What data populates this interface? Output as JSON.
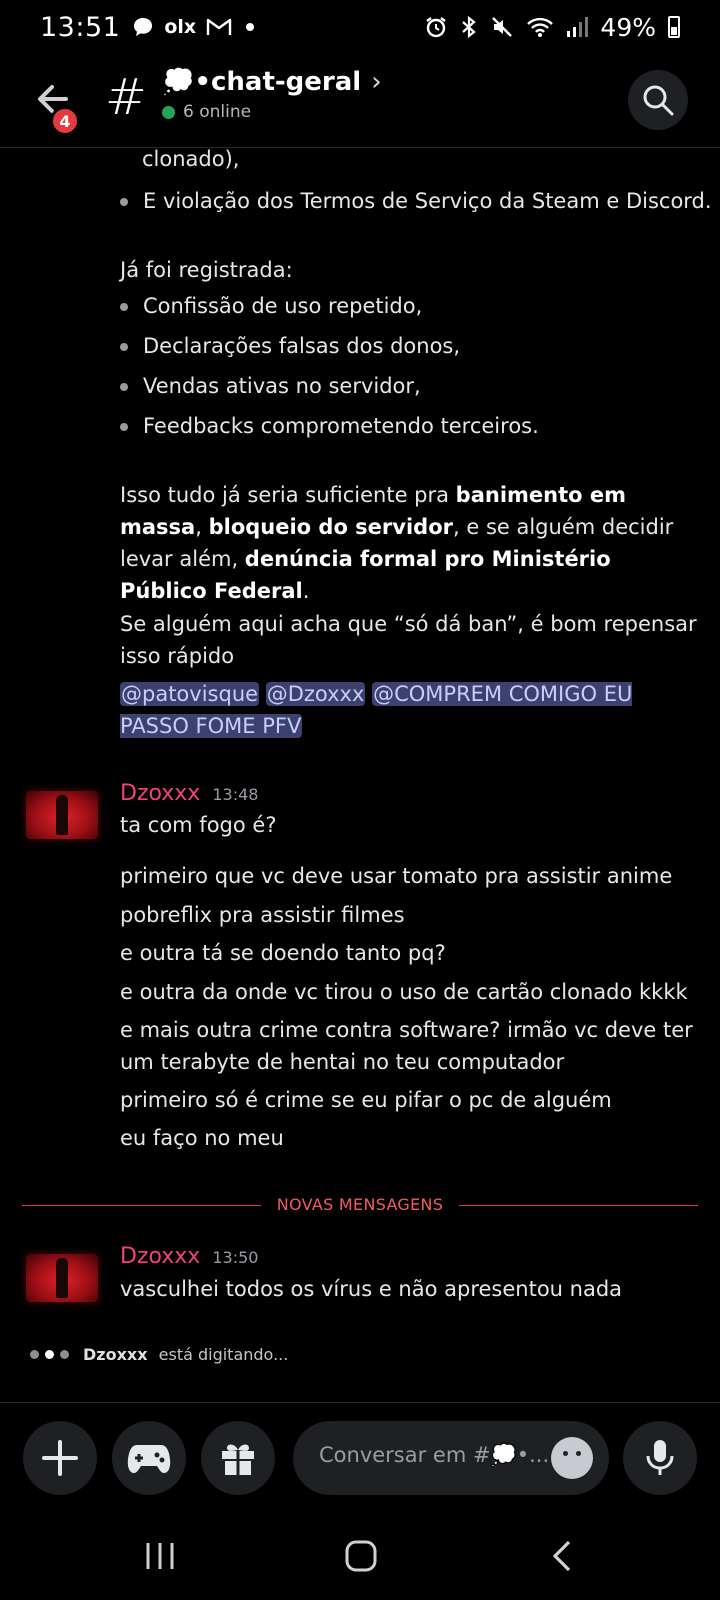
{
  "status_bar": {
    "time": "13:51",
    "left_icons": [
      "chat-bubble-icon",
      "olx-icon",
      "gmail-icon",
      "dot-icon"
    ],
    "olx_text": "olx",
    "battery": "49%",
    "right_icons": [
      "alarm-icon",
      "bluetooth-icon",
      "mute-icon",
      "wifi-icon",
      "signal-icon",
      "battery-icon"
    ]
  },
  "header": {
    "back_badge": "4",
    "channel_name": "💭•chat-geral",
    "chevron": "›",
    "online_text": "6 online",
    "online_color": "#23a55a"
  },
  "messages": {
    "top_block": {
      "partial_line": "clonado),",
      "bullet_1": "E violação dos Termos de Serviço da Steam e Discord.",
      "registered_heading": "Já foi registrada:",
      "registered_items": [
        "Confissão de uso repetido,",
        "Declarações falsas dos donos,",
        "Vendas ativas no servidor,",
        "Feedbacks comprometendo terceiros."
      ],
      "para_1_start": "Isso tudo já seria suficiente pra ",
      "para_1_bold_1": "banimento em massa",
      "para_1_mid_1": ", ",
      "para_1_bold_2": "bloqueio do servidor",
      "para_1_mid_2": ", e se alguém decidir levar além, ",
      "para_1_bold_3": "denúncia formal pro Ministério Público Federal",
      "para_1_end": ".",
      "para_2": "Se alguém aqui acha que “só dá ban”, é bom repensar isso rápido",
      "mentions": [
        "@patovisque",
        "@Dzoxxx",
        "@COMPREM COMIGO EU PASSO FOME PFV"
      ]
    },
    "group_1": {
      "author": "Dzoxxx",
      "time": "13:48",
      "lines": [
        "ta com fogo é?",
        "primeiro que vc deve usar tomato pra assistir anime",
        "pobreflix pra assistir filmes",
        "e outra tá se doendo tanto pq?",
        "e outra da onde vc tirou o uso de cartão clonado kkkk",
        "e mais outra crime contra software? irmão vc deve ter um terabyte de hentai no teu computador",
        "primeiro só é crime se eu pifar o pc de alguém",
        "eu faço no meu"
      ]
    },
    "divider_label": "NOVAS MENSAGENS",
    "group_2": {
      "author": "Dzoxxx",
      "time": "13:50",
      "lines": [
        "vasculhei todos os vírus e não apresentou nada"
      ]
    },
    "author_color": "#f0417e"
  },
  "typing": {
    "name": "Dzoxxx",
    "text": " está digitando..."
  },
  "composer": {
    "placeholder": "Conversar em #💭•...",
    "buttons": [
      "plus-icon",
      "gamepad-icon",
      "gift-icon",
      "emoji-icon",
      "microphone-icon"
    ]
  },
  "navbar": {
    "buttons": [
      "recent-apps-icon",
      "home-icon",
      "back-icon"
    ]
  },
  "colors": {
    "background": "#000000",
    "mention_bg": "#3c4170",
    "mention_fg": "#c9cdfb",
    "new_messages": "#e5393d",
    "badge": "#e5393d"
  }
}
